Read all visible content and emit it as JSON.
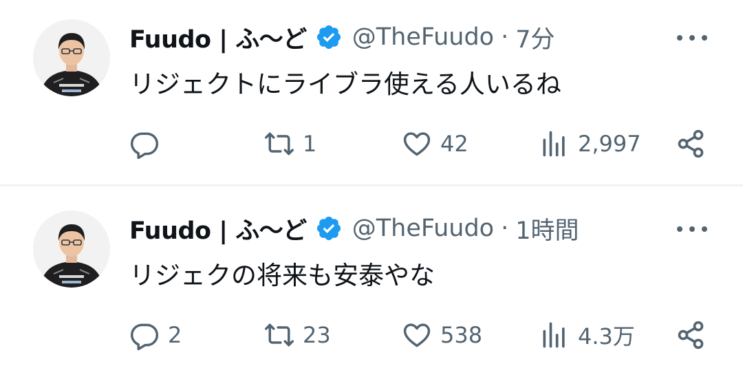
{
  "colors": {
    "text": "#0f1419",
    "secondary": "#536471",
    "verified": "#1d9bf0",
    "divider": "#eff3f4"
  },
  "tweets": [
    {
      "name": "Fuudo | ふ〜ど",
      "handle": "@TheFuudo",
      "separator": "·",
      "time": "7分",
      "text": "リジェクトにライブラ使える人いるね",
      "replies": "",
      "retweets": "1",
      "likes": "42",
      "views": "2,997"
    },
    {
      "name": "Fuudo | ふ〜ど",
      "handle": "@TheFuudo",
      "separator": "·",
      "time": "1時間",
      "text": "リジェクの将来も安泰やな",
      "replies": "2",
      "retweets": "23",
      "likes": "538",
      "views": "4.3万"
    }
  ],
  "icons": {
    "verified": "verified-badge-icon",
    "more": "more-options-icon",
    "reply": "reply-icon",
    "retweet": "retweet-icon",
    "like": "heart-icon",
    "views": "views-icon",
    "share": "share-icon"
  }
}
